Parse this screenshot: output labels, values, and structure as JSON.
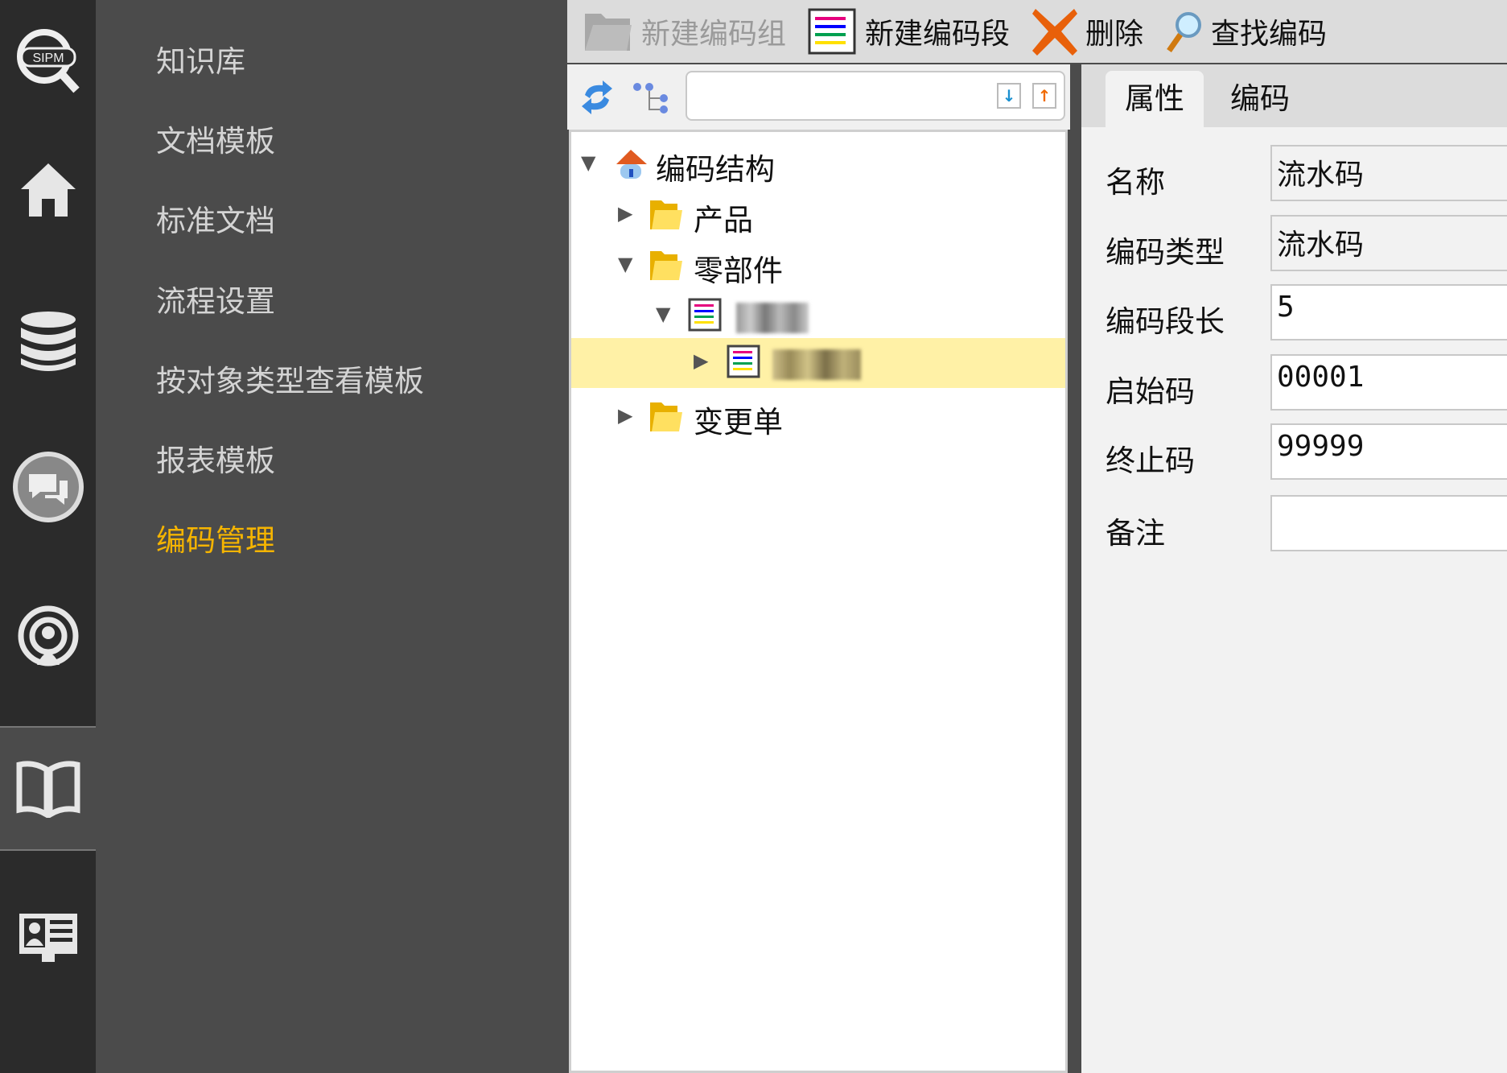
{
  "iconbar": [
    {
      "name": "sipm-logo-icon",
      "text": "SIPM"
    },
    {
      "name": "home-icon"
    },
    {
      "name": "database-icon"
    },
    {
      "name": "chat-icon"
    },
    {
      "name": "broadcast-icon"
    },
    {
      "name": "book-icon"
    },
    {
      "name": "id-card-icon"
    }
  ],
  "menu": {
    "items": [
      "知识库",
      "文档模板",
      "标准文档",
      "流程设置",
      "按对象类型查看模板",
      "报表模板",
      "编码管理"
    ],
    "active_index": 6,
    "active_color": "#f5b400"
  },
  "toolbar": {
    "new_group": "新建编码组",
    "new_segment": "新建编码段",
    "delete": "删除",
    "find": "查找编码"
  },
  "search": {
    "value": "",
    "placeholder": ""
  },
  "tree": {
    "root": "编码结构",
    "products": "产品",
    "parts": "零部件",
    "changes": "变更单"
  },
  "tabs": {
    "properties": "属性",
    "code": "编码"
  },
  "form": {
    "name_label": "名称",
    "name_value": "流水码",
    "type_label": "编码类型",
    "type_value": "流水码",
    "length_label": "编码段长",
    "length_value": "5",
    "start_label": "启始码",
    "start_value": "00001",
    "end_label": "终止码",
    "end_value": "99999",
    "note_label": "备注",
    "note_value": ""
  }
}
